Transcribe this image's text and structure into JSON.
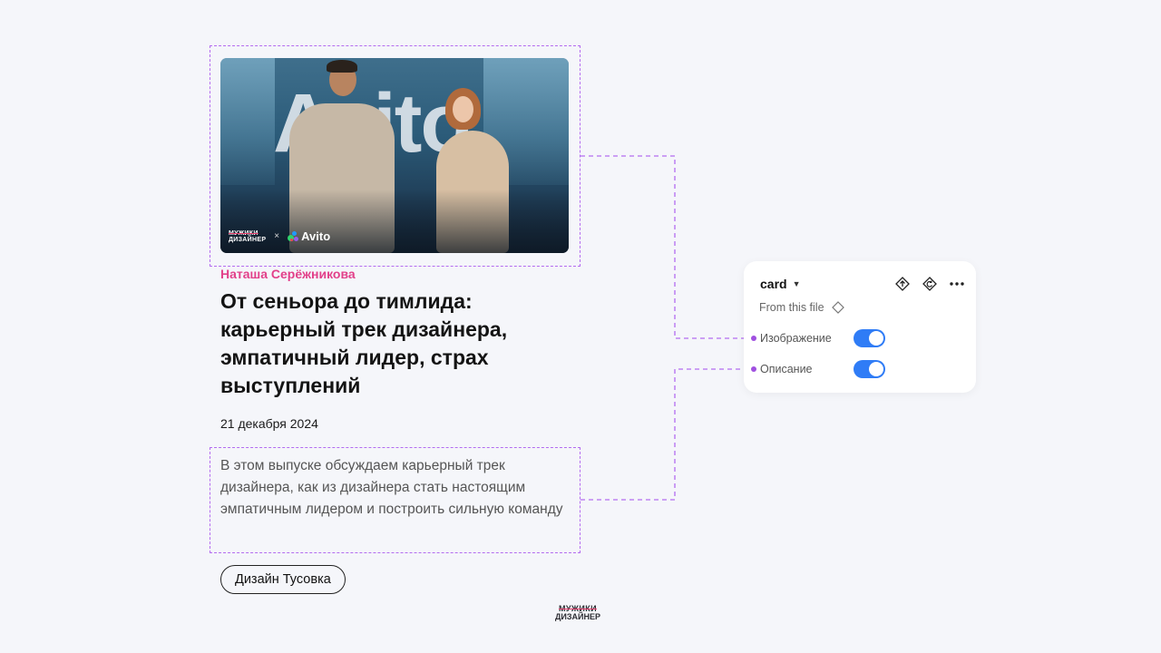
{
  "card": {
    "cover": {
      "backdrop_text": "Avito",
      "brand_small_top": "МУЖИКИ",
      "brand_small_bottom": "ДИЗАЙНЕР",
      "brand_cross": "×",
      "brand_partner": "Avito"
    },
    "author": "Наташа Серёжникова",
    "title": "От сеньора до тимлида: карьерный трек дизайнера, эмпатичный лидер, страх выступлений",
    "date": "21 декабря 2024",
    "description": "В этом выпуске обсуждаем карьерный трек дизайнера, как из дизайнера стать настоящим эмпатичным лидером и построить сильную команду",
    "tag": "Дизайн Тусовка"
  },
  "footer": {
    "logo_top": "МУЖИКИ",
    "logo_bottom": "ДИЗАЙНЕР"
  },
  "panel": {
    "component_name": "card",
    "source": "From this file",
    "properties": [
      {
        "label": "Изображение",
        "enabled": true
      },
      {
        "label": "Описание",
        "enabled": true
      }
    ],
    "icons": [
      "go-to-main-component-icon",
      "reset-icon",
      "more-icon",
      "component-diamond-icon",
      "chevron-down-icon"
    ]
  },
  "colors": {
    "accent_pink": "#e2408a",
    "toggle_blue": "#2f7cf6",
    "dash_purple": "#b36cf0",
    "background": "#f5f6fa"
  }
}
